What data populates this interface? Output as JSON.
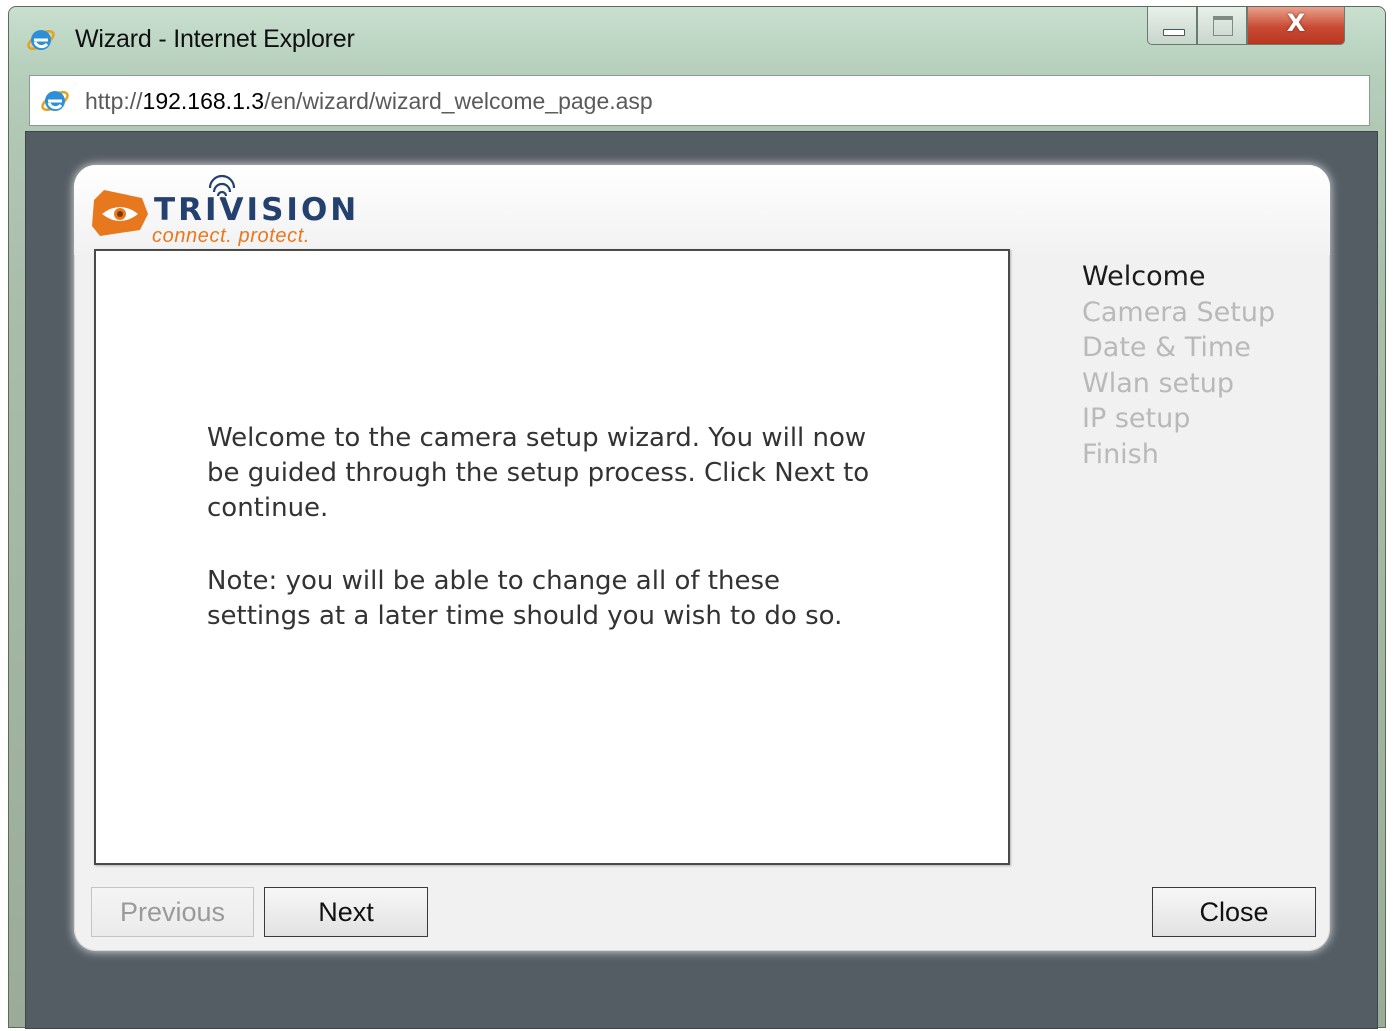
{
  "window": {
    "title": "Wizard - Internet Explorer",
    "minimize_icon": "minimize-icon",
    "maximize_icon": "maximize-icon",
    "close_glyph": "X"
  },
  "address": {
    "scheme": "http://",
    "host": "192.168.1.3",
    "path": "/en/wizard/wizard_welcome_page.asp"
  },
  "logo": {
    "word": "TRIVISION",
    "tagline": "connect. protect."
  },
  "content": {
    "paragraph1": "Welcome to the camera setup wizard. You will now be guided through the setup process. Click Next to continue.",
    "paragraph2": "Note: you will be able to change all of these settings at a later time should you wish to do so."
  },
  "steps": [
    {
      "label": "Welcome",
      "active": true
    },
    {
      "label": "Camera Setup",
      "active": false
    },
    {
      "label": "Date & Time",
      "active": false
    },
    {
      "label": "Wlan setup",
      "active": false
    },
    {
      "label": "IP setup",
      "active": false
    },
    {
      "label": "Finish",
      "active": false
    }
  ],
  "buttons": {
    "previous": "Previous",
    "next": "Next",
    "close": "Close"
  },
  "colors": {
    "logo_orange": "#e8781e",
    "logo_blue": "#24406f",
    "viewport_bg": "#545c64"
  }
}
